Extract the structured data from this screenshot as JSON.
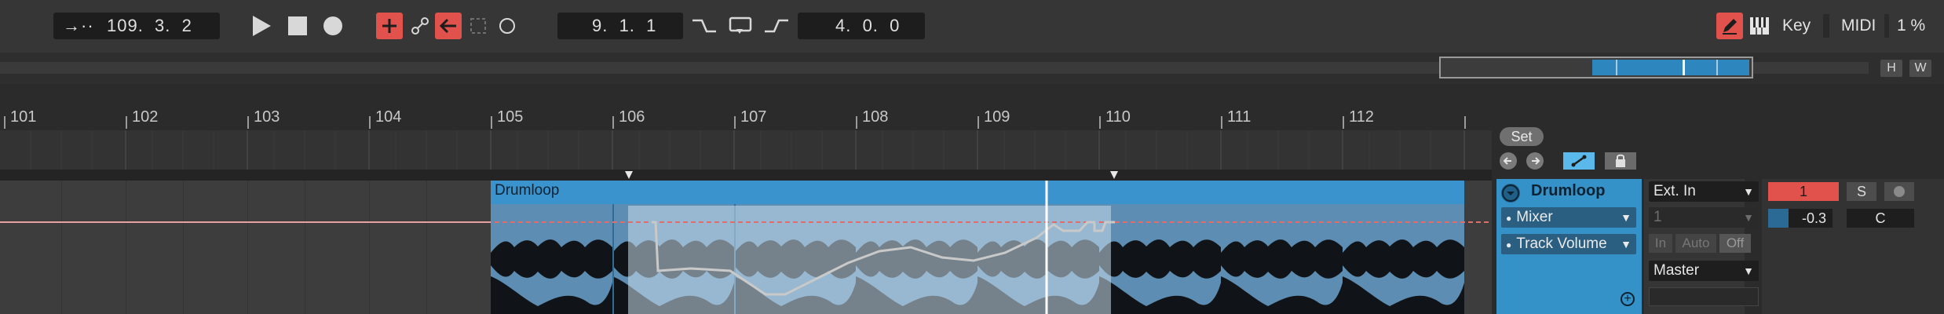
{
  "transport": {
    "follow_icon": "follow-icon",
    "arrangement_position": "109.  3.  2",
    "loop_start": "9.  1.  1",
    "loop_length": "4.  0.  0",
    "key_label": "Key",
    "midi_label": "MIDI",
    "cpu_label": "1 %"
  },
  "overview": {
    "h_label": "H",
    "w_label": "W"
  },
  "ruler": {
    "bars": [
      "101",
      "102",
      "103",
      "104",
      "105",
      "106",
      "107",
      "108",
      "109",
      "110",
      "111",
      "112"
    ]
  },
  "clip": {
    "name": "Drumloop"
  },
  "track_header": {
    "set_label": "Set",
    "track_name": "Drumloop",
    "device_chooser": "Mixer",
    "parameter_chooser": "Track Volume"
  },
  "io": {
    "input_type": "Ext. In",
    "input_channel": "1",
    "monitor_in": "In",
    "monitor_auto": "Auto",
    "monitor_off": "Off",
    "output_type": "Master"
  },
  "mixer": {
    "track_activator": "1",
    "solo_label": "S",
    "volume_value": "-0.3",
    "pan_value": "C"
  },
  "colors": {
    "clip": "#3a93cc",
    "transport_active": "#e0524b",
    "automation_line": "#cfcfcf",
    "overview_fill": "#2e86bf"
  }
}
